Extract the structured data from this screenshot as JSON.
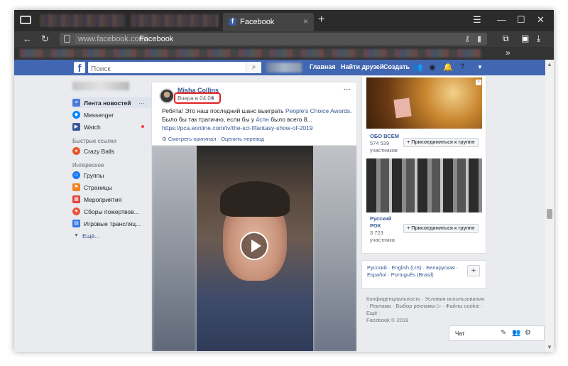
{
  "browser": {
    "tab_title": "Facebook",
    "tab_favicon": "f",
    "tab_close": "×",
    "new_tab": "+",
    "url_domain": "www.facebook.com",
    "url_title": "Facebook",
    "bookmarks_more": "»"
  },
  "fb": {
    "logo": "f",
    "search_placeholder": "Поиск",
    "nav": {
      "home": "Главная",
      "find_friends": "Найти друзей",
      "create": "Создать"
    },
    "colors": {
      "brand": "#4267b2",
      "link": "#385898"
    }
  },
  "sidebar": {
    "items": [
      {
        "label": "Лента новостей",
        "icon": "news-feed-icon",
        "active": true
      },
      {
        "label": "Messenger",
        "icon": "messenger-icon"
      },
      {
        "label": "Watch",
        "icon": "watch-icon"
      }
    ],
    "more_dots": "···",
    "shortcuts_heading": "Быстрые ссылки",
    "shortcuts": [
      {
        "label": "Crazy Balls",
        "icon": "crazy-balls-icon"
      }
    ],
    "explore_heading": "Интересное",
    "explore": [
      {
        "label": "Группы",
        "icon": "groups-icon"
      },
      {
        "label": "Страницы",
        "icon": "pages-icon"
      },
      {
        "label": "Мероприятия",
        "icon": "events-icon"
      },
      {
        "label": "Сборы пожертвов...",
        "icon": "fundraisers-icon"
      },
      {
        "label": "Игровые трансляц...",
        "icon": "gaming-video-icon"
      }
    ],
    "see_more": "Ещё..."
  },
  "post": {
    "author": "Misha Collins",
    "time": "Вчера в 04:06",
    "menu": "···",
    "text_before": "Ребята! Это наш последний шанс выиграть ",
    "text_link": "People's Choice Awards",
    "text_mid": ". Было бы так трагично, если бы у ",
    "hashtag": "#спн",
    "text_after": " было всего 8...",
    "link_url": "https://pca.eonline.com/tv/the-sci-fifantasy-show-of-2019",
    "see_original": "Смотреть оригинал",
    "rate_translation": "Оценить перевод",
    "tools_sep": " · "
  },
  "groups": [
    {
      "name": "ОБО ВСЕМ",
      "members": "574 539",
      "members_label": "участников",
      "join": "+ Присоединиться к группе"
    },
    {
      "name": "Русский РОК",
      "members": "3 723",
      "members_label": "участника",
      "join": "+ Присоединиться к группе"
    }
  ],
  "languages": {
    "text": "Русский · English (US) · Беларуская · Español · Português (Brasil)",
    "add": "+"
  },
  "footer": {
    "text": "Конфиденциальность · Условия использования · Реклама · Выбор рекламы ▷ · Файлы cookie · Ещё ·",
    "copyright": "Facebook © 2019"
  },
  "chat": {
    "label": "Чат"
  }
}
